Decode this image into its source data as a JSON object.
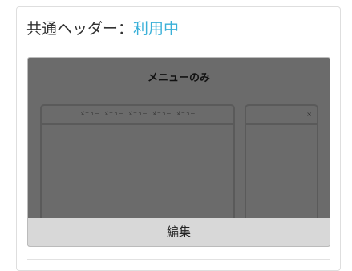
{
  "header": {
    "label": "共通ヘッダー：",
    "status": "利用中",
    "status_color": "#3ab0d8"
  },
  "preview": {
    "title": "メニューのみ",
    "menu_items": [
      "メニュー",
      "メニュー",
      "メニュー",
      "メニュー",
      "メニュー"
    ],
    "close_glyph": "×",
    "edit_label": "編集"
  }
}
